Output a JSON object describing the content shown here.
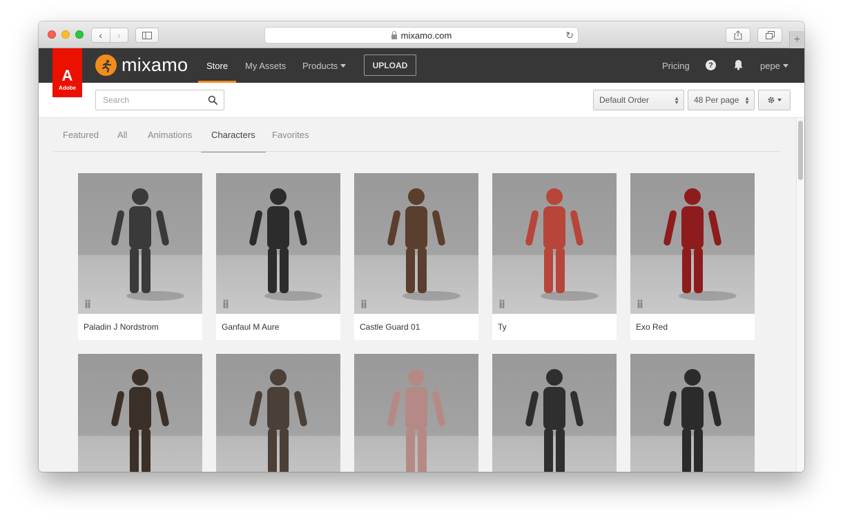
{
  "browser": {
    "url": "mixamo.com",
    "back": "‹",
    "forward": "›",
    "new_tab": "+"
  },
  "header": {
    "adobe_label": "Adobe",
    "logo": "mixamo",
    "nav": [
      "Store",
      "My Assets",
      "Products",
      "UPLOAD",
      "Pricing",
      "pepe"
    ],
    "help": "?"
  },
  "toolbar": {
    "search_placeholder": "Search",
    "sort_value": "Default Order",
    "per_page_value": "48 Per page"
  },
  "tabs": [
    "Featured",
    "All",
    "Animations",
    "Characters",
    "Favorites"
  ],
  "active_tab": "Characters",
  "characters": [
    {
      "name": "Paladin J Nordstrom",
      "color": "#3a3a3a"
    },
    {
      "name": "Ganfaul M Aure",
      "color": "#2c2c2c"
    },
    {
      "name": "Castle Guard 01",
      "color": "#5a3e2e"
    },
    {
      "name": "Ty",
      "color": "#b8453a"
    },
    {
      "name": "Exo Red",
      "color": "#8e1c1c"
    },
    {
      "name": "",
      "color": "#3b3028"
    },
    {
      "name": "",
      "color": "#4a4038"
    },
    {
      "name": "",
      "color": "#b58a86"
    },
    {
      "name": "",
      "color": "#2f2f2f"
    },
    {
      "name": "",
      "color": "#2b2b2b"
    }
  ],
  "colors": {
    "accent": "#f28c1b",
    "adobe_red": "#eb1000",
    "nav_bg": "#373737"
  }
}
